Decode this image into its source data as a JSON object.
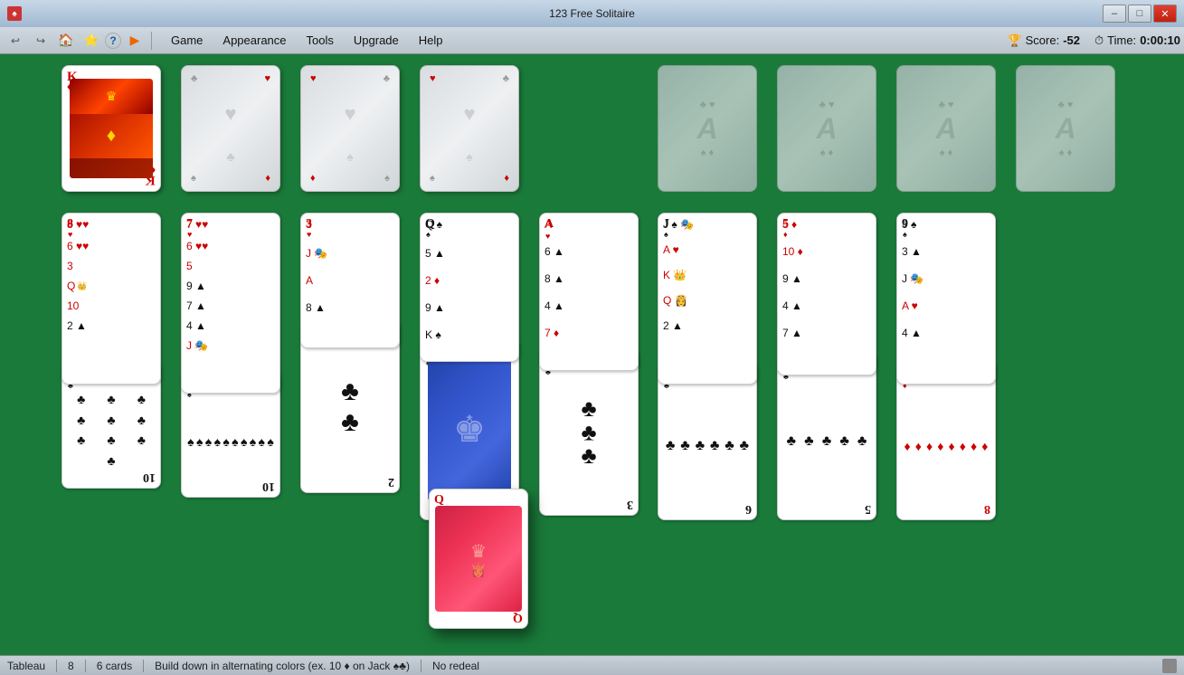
{
  "titleBar": {
    "title": "123 Free Solitaire",
    "minimizeLabel": "–",
    "maximizeLabel": "□",
    "closeLabel": "✕"
  },
  "toolbar": {
    "icons": [
      "↩",
      "↪",
      "🏠",
      "⭐",
      "?",
      "⊕"
    ],
    "menus": [
      "Game",
      "Appearance",
      "Tools",
      "Upgrade",
      "Help"
    ]
  },
  "stats": {
    "scoreLabel": "Score:",
    "scoreValue": "-52",
    "timeLabel": "Time:",
    "timeValue": "0:00:10"
  },
  "statusBar": {
    "gameType": "Tableau",
    "colCount": "8",
    "cardCount": "6 cards",
    "buildRule": "Build down in alternating colors (ex. 10 ♦ on Jack ♠♣)",
    "redealRule": "No redeal"
  },
  "piles": {
    "stock1": {
      "rank": "",
      "suit": ""
    },
    "stock2": {
      "rank": "",
      "suit": ""
    },
    "stock3": {
      "rank": "",
      "suit": ""
    },
    "stock4": {
      "rank": "",
      "suit": ""
    }
  }
}
